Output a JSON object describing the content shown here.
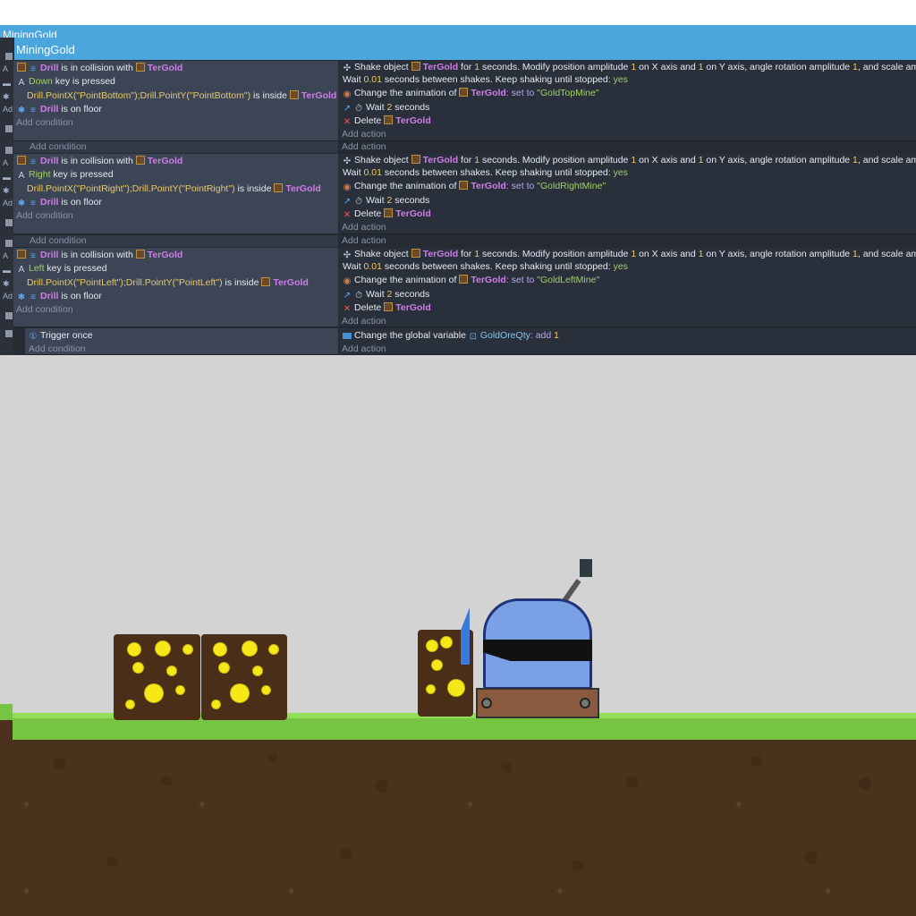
{
  "window": {
    "outer_title": "MiningGold",
    "group_title": "MiningGold"
  },
  "events": [
    {
      "conditions": [
        {
          "object": "Drill",
          "text": " is in collision with ",
          "target": "TerGold"
        },
        {
          "key": "Down",
          "text": " key is pressed"
        },
        {
          "expr": "Drill.PointX(\"PointBottom\");Drill.PointY(\"PointBottom\")",
          "text": " is inside ",
          "target": "TerGold"
        },
        {
          "object": "Drill",
          "text": " is on floor"
        }
      ],
      "add_condition": "Add condition",
      "actions": [
        {
          "shake_prefix": "Shake object ",
          "object": "TerGold",
          "for": " for ",
          "seconds": "1",
          "rest": " seconds. Modify position amplitude ",
          "amp": "1",
          "mid": " on X axis and ",
          "amp2": "1",
          "mid2": " on Y axis, angle rotation amplitude ",
          "amp3": "1",
          "end": ", and scale amplitude"
        },
        {
          "wait_prefix": "Wait ",
          "interval": "0.01",
          "wait_rest": " seconds between shakes. Keep shaking until stopped: ",
          "yes": "yes"
        },
        {
          "anim_prefix": "Change the animation of ",
          "object": "TerGold",
          "set": ": set to ",
          "anim": "\"GoldTopMine\""
        },
        {
          "wait": "Wait ",
          "num": "2",
          "unit": " seconds"
        },
        {
          "delete": "Delete ",
          "object": "TerGold"
        }
      ],
      "add_action": "Add action"
    },
    {
      "conditions": [
        {
          "object": "Drill",
          "text": " is in collision with ",
          "target": "TerGold"
        },
        {
          "key": "Right",
          "text": " key is pressed"
        },
        {
          "expr": "Drill.PointX(\"PointRight\");Drill.PointY(\"PointRight\")",
          "text": " is inside ",
          "target": "TerGold"
        },
        {
          "object": "Drill",
          "text": " is on floor"
        }
      ],
      "add_condition": "Add condition",
      "actions": [
        {
          "shake_prefix": "Shake object ",
          "object": "TerGold",
          "for": " for ",
          "seconds": "1",
          "rest": " seconds. Modify position amplitude ",
          "amp": "1",
          "mid": " on X axis and ",
          "amp2": "1",
          "mid2": " on Y axis, angle rotation amplitude ",
          "amp3": "1",
          "end": ", and scale amplitude"
        },
        {
          "wait_prefix": "Wait ",
          "interval": "0.01",
          "wait_rest": " seconds between shakes. Keep shaking until stopped: ",
          "yes": "yes"
        },
        {
          "anim_prefix": "Change the animation of ",
          "object": "TerGold",
          "set": ": set to ",
          "anim": "\"GoldRightMine\""
        },
        {
          "wait": "Wait ",
          "num": "2",
          "unit": " seconds"
        },
        {
          "delete": "Delete ",
          "object": "TerGold"
        }
      ],
      "add_action": "Add action"
    },
    {
      "conditions": [
        {
          "object": "Drill",
          "text": " is in collision with ",
          "target": "TerGold"
        },
        {
          "key": "Left",
          "text": " key is pressed"
        },
        {
          "expr": "Drill.PointX(\"PointLeft\");Drill.PointY(\"PointLeft\")",
          "text": " is inside ",
          "target": "TerGold"
        },
        {
          "object": "Drill",
          "text": " is on floor"
        }
      ],
      "add_condition": "Add condition",
      "actions": [
        {
          "shake_prefix": "Shake object ",
          "object": "TerGold",
          "for": " for ",
          "seconds": "1",
          "rest": " seconds. Modify position amplitude ",
          "amp": "1",
          "mid": " on X axis and ",
          "amp2": "1",
          "mid2": " on Y axis, angle rotation amplitude ",
          "amp3": "1",
          "end": ", and scale amplitude"
        },
        {
          "wait_prefix": "Wait ",
          "interval": "0.01",
          "wait_rest": " seconds between shakes. Keep shaking until stopped: ",
          "yes": "yes"
        },
        {
          "anim_prefix": "Change the animation of ",
          "object": "TerGold",
          "set": ": set to ",
          "anim": "\"GoldLeftMine\""
        },
        {
          "wait": "Wait ",
          "num": "2",
          "unit": " seconds"
        },
        {
          "delete": "Delete ",
          "object": "TerGold"
        }
      ],
      "add_action": "Add action"
    }
  ],
  "subevent": {
    "condition": "Trigger once",
    "add_condition": "Add condition",
    "action_prefix": "Change the global variable ",
    "variable": "GoldOreQty",
    "op": ": add ",
    "value": "1",
    "add_action": "Add action"
  },
  "between_add_condition": "Add condition",
  "gutter_clip": "Ad",
  "colors": {
    "header": "#4aa6dc",
    "editor_bg": "#262b33",
    "object": "#d07ce8",
    "gold": "#f6e818",
    "grass": "#76c442",
    "dirt": "#4a321c"
  },
  "icons": [
    "object-icon",
    "keyboard-icon",
    "point-icon",
    "platformer-icon",
    "shake-icon",
    "animation-icon",
    "timer-icon",
    "delete-icon",
    "variable-icon",
    "trigger-once-icon"
  ]
}
